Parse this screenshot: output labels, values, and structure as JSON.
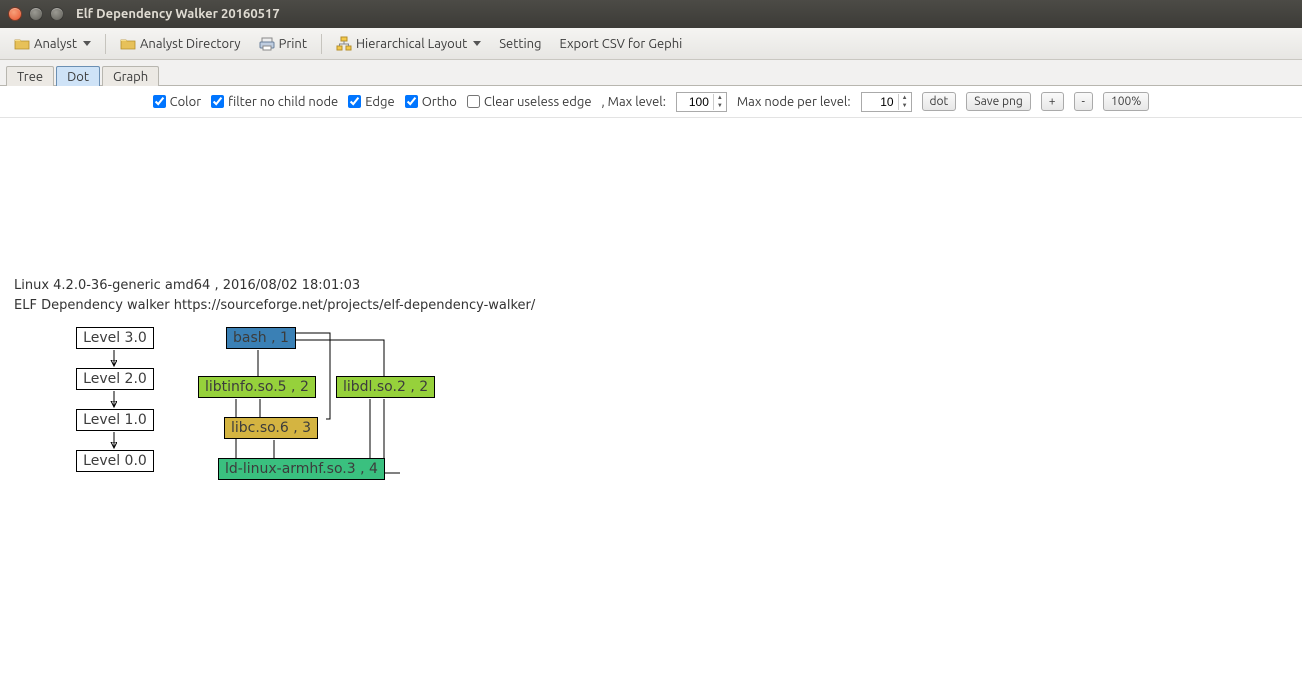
{
  "window": {
    "title": "Elf Dependency Walker 20160517"
  },
  "toolbar": {
    "analyst": "Analyst",
    "analyst_directory": "Analyst Directory",
    "print": "Print",
    "hierarchical_layout": "Hierarchical Layout",
    "setting": "Setting",
    "export_csv": "Export CSV for Gephi"
  },
  "tabs": {
    "tree": "Tree",
    "dot": "Dot",
    "graph": "Graph",
    "active": "dot"
  },
  "options": {
    "color_label": "Color",
    "color_checked": true,
    "filter_label": "filter no child node",
    "filter_checked": true,
    "edge_label": "Edge",
    "edge_checked": true,
    "ortho_label": "Ortho",
    "ortho_checked": true,
    "clear_label": "Clear useless edge",
    "clear_checked": false,
    "max_level_label": ", Max level:",
    "max_level_value": "100",
    "max_node_label": "Max node per level:",
    "max_node_value": "10",
    "dot_btn": "dot",
    "save_png_btn": "Save png",
    "zoom_in": "+",
    "zoom_out": "-",
    "zoom_level": "100%"
  },
  "meta": {
    "line1": "Linux 4.2.0-36-generic amd64 , 2016/08/02 18:01:03",
    "line2": "ELF Dependency walker https://sourceforge.net/projects/elf-dependency-walker/"
  },
  "levels": {
    "l3": "Level 3.0",
    "l2": "Level 2.0",
    "l1": "Level 1.0",
    "l0": "Level 0.0"
  },
  "nodes": {
    "bash": {
      "label": "bash , 1",
      "color": "#3a80b5"
    },
    "libtinfo": {
      "label": "libtinfo.so.5 , 2",
      "color": "#96d13b"
    },
    "libdl": {
      "label": "libdl.so.2 , 2",
      "color": "#96d13b"
    },
    "libc": {
      "label": "libc.so.6 , 3",
      "color": "#d4b441"
    },
    "ldlinux": {
      "label": "ld-linux-armhf.so.3 , 4",
      "color": "#3ac07f"
    }
  }
}
